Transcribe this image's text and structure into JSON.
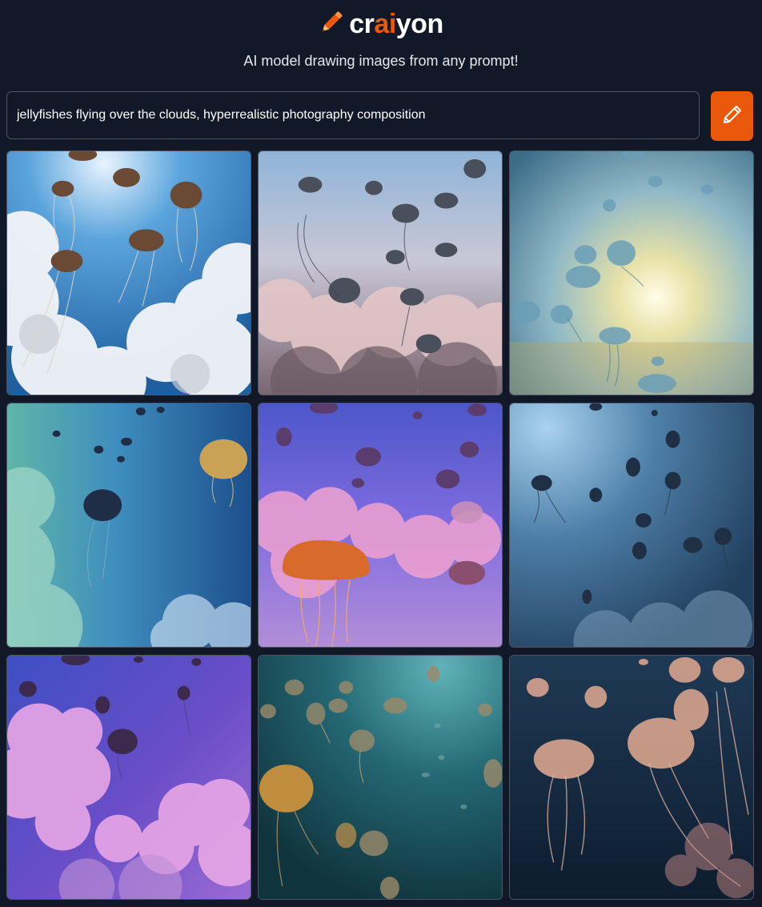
{
  "header": {
    "logo_prefix": "cr",
    "logo_accent": "ai",
    "logo_suffix": "yon",
    "tagline": "AI model drawing images from any prompt!",
    "accent_color": "#ea580c"
  },
  "prompt": {
    "value": "jellyfishes flying over the clouds, hyperrealistic photography composition",
    "draw_icon": "pencil-icon"
  },
  "results": [
    {
      "scene": "blue sky, white clouds, brown jellyfish"
    },
    {
      "scene": "dusky sky, pink clouds, grey jellyfish"
    },
    {
      "scene": "golden sun glare, pale blue jellyfish"
    },
    {
      "scene": "teal haze, dark jellyfish, golden jellyfish"
    },
    {
      "scene": "purple sky, pink cloud, orange jellyfish"
    },
    {
      "scene": "steel blue sky, dark jellyfish"
    },
    {
      "scene": "violet sky, pink clouds, dark jellyfish"
    },
    {
      "scene": "deep teal water, amber jellyfish"
    },
    {
      "scene": "dark navy water, pink jellyfish"
    }
  ]
}
